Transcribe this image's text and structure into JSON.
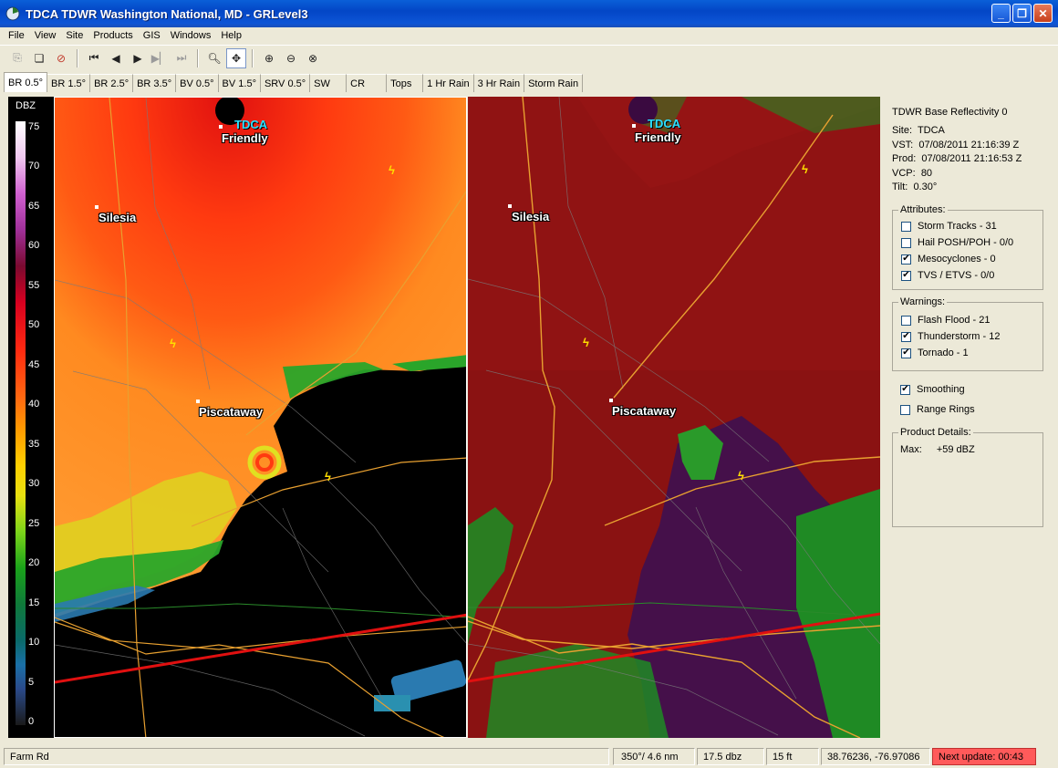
{
  "window": {
    "title": "TDCA  TDWR Washington National, MD - GRLevel3",
    "controls": [
      "minimize",
      "restore",
      "close"
    ]
  },
  "menu": [
    "File",
    "View",
    "Site",
    "Products",
    "GIS",
    "Windows",
    "Help"
  ],
  "toolbar": {
    "icons": [
      "copy-icon",
      "copy-pages-icon",
      "stop-icon",
      "first-frame-icon",
      "prev-frame-icon",
      "play-icon",
      "next-frame-icon",
      "last-frame-icon",
      "zoom-icon",
      "pan-icon",
      "zoom-in-icon",
      "zoom-out-icon",
      "zoom-reset-icon"
    ]
  },
  "tabs": [
    "BR 0.5°",
    "BR 1.5°",
    "BR 2.5°",
    "BR 3.5°",
    "BV 0.5°",
    "BV 1.5°",
    "SRV 0.5°",
    "SW",
    "CR",
    "Tops",
    "1 Hr Rain",
    "3 Hr Rain",
    "Storm Rain"
  ],
  "active_tab": "BR 0.5°",
  "legend": {
    "title": "DBZ",
    "ticks": [
      "75",
      "70",
      "65",
      "60",
      "55",
      "50",
      "45",
      "40",
      "35",
      "30",
      "25",
      "20",
      "15",
      "10",
      "5",
      "0"
    ]
  },
  "map": {
    "site": "TDCA",
    "places": [
      "Friendly",
      "Silesia",
      "Piscataway"
    ]
  },
  "info": {
    "product_title": "TDWR Base Reflectivity 0",
    "meta": [
      {
        "label": "Site:",
        "value": "TDCA"
      },
      {
        "label": "VST:",
        "value": "07/08/2011  21:16:39 Z"
      },
      {
        "label": "Prod:",
        "value": "07/08/2011  21:16:53 Z"
      },
      {
        "label": "VCP:",
        "value": "80"
      },
      {
        "label": "Tilt:",
        "value": "0.30°"
      }
    ],
    "attributes_title": "Attributes:",
    "attributes": [
      {
        "label": "Storm Tracks - 31",
        "checked": false
      },
      {
        "label": "Hail POSH/POH - 0/0",
        "checked": false
      },
      {
        "label": "Mesocyclones - 0",
        "checked": true
      },
      {
        "label": "TVS / ETVS - 0/0",
        "checked": true
      }
    ],
    "warnings_title": "Warnings:",
    "warnings": [
      {
        "label": "Flash Flood - 21",
        "checked": false
      },
      {
        "label": "Thunderstorm - 12",
        "checked": true
      },
      {
        "label": "Tornado - 1",
        "checked": true
      }
    ],
    "smoothing": {
      "label": "Smoothing",
      "checked": true
    },
    "range_rings": {
      "label": "Range Rings",
      "checked": false
    },
    "details_title": "Product Details:",
    "max_label": "Max:",
    "max_value": "+59 dBZ"
  },
  "status": {
    "road": "Farm Rd",
    "azimuth_range": "350°/ 4.6 nm",
    "value": "17.5 dbz",
    "height": "15 ft",
    "coords": "38.76236, -76.97086",
    "next_update": "Next update: 00:43"
  },
  "colors": {
    "title_bar": "#0346c6",
    "warning_line": "#e01010",
    "next_update_bg": "#ff5a5a"
  }
}
